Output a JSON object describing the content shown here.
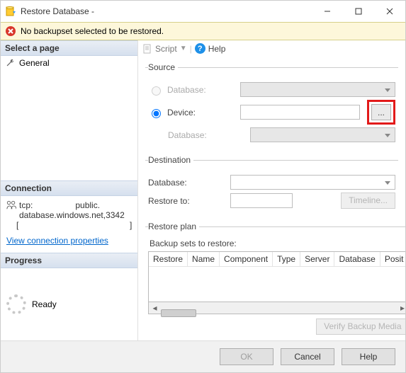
{
  "window": {
    "title": "Restore Database -"
  },
  "error": {
    "text": "No backupset selected to be restored."
  },
  "left": {
    "select_page": "Select a page",
    "pages": {
      "general": "General"
    },
    "connection_header": "Connection",
    "connection_text1": "tcp:                  public.",
    "connection_text2": "database.windows.net,3342",
    "connection_text3": "[                                               ]",
    "view_props": "View connection properties",
    "progress_header": "Progress",
    "progress_status": "Ready"
  },
  "toolbar": {
    "script": "Script",
    "help": "Help"
  },
  "source": {
    "legend": "Source",
    "database_radio": "Database:",
    "device_radio": "Device:",
    "device_value": "",
    "browse": "...",
    "database_label": "Database:"
  },
  "destination": {
    "legend": "Destination",
    "database_label": "Database:",
    "database_value": "",
    "restore_to_label": "Restore to:",
    "restore_to_value": "",
    "timeline": "Timeline..."
  },
  "plan": {
    "legend": "Restore plan",
    "backup_sets": "Backup sets to restore:",
    "cols": {
      "restore": "Restore",
      "name": "Name",
      "component": "Component",
      "type": "Type",
      "server": "Server",
      "database": "Database",
      "position": "Posit"
    },
    "verify": "Verify Backup Media"
  },
  "footer": {
    "ok": "OK",
    "cancel": "Cancel",
    "help": "Help"
  }
}
